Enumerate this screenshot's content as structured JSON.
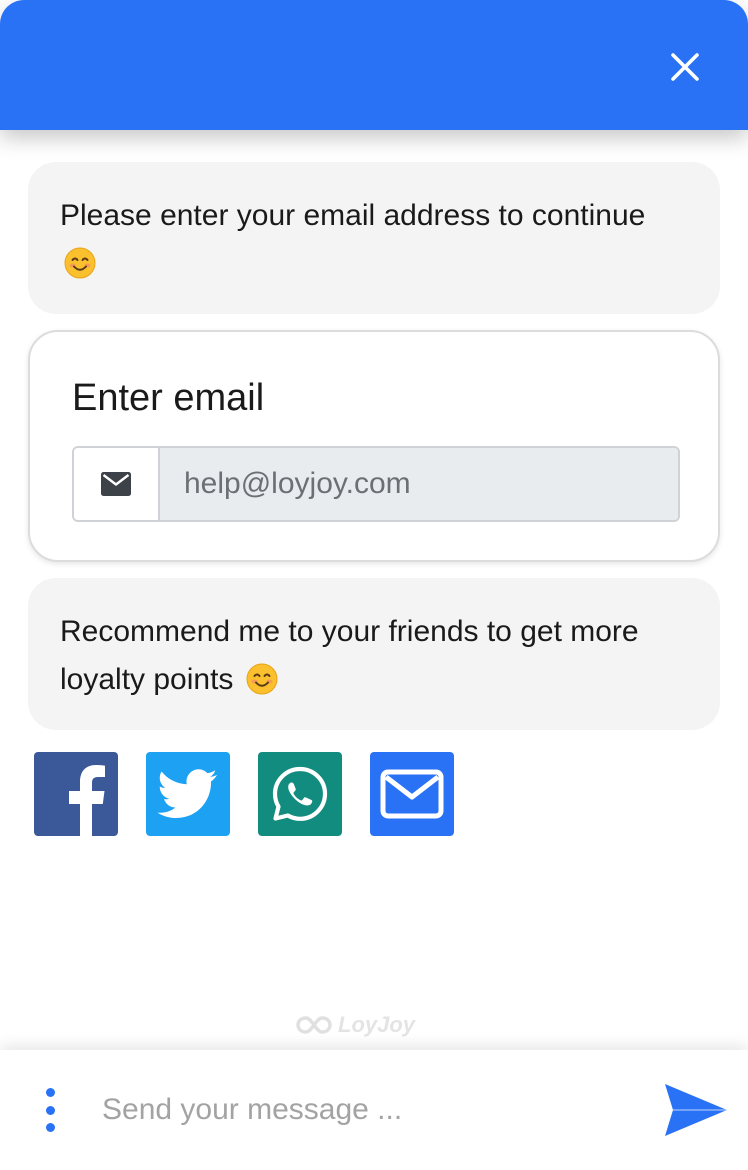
{
  "colors": {
    "header": "#2a72f5",
    "bubble": "#f4f4f4",
    "facebook": "#3b5998",
    "twitter": "#1da1f2",
    "whatsapp": "#128c7e",
    "email": "#2a72f5"
  },
  "header": {
    "close_icon": "close-icon"
  },
  "messages": [
    {
      "text": "Please enter your email address to continue",
      "emoji": "smiling-face-emoji"
    },
    {
      "text": "Recommend me to your friends to get more loyalty points",
      "emoji": "smiling-face-emoji"
    }
  ],
  "email_form": {
    "title": "Enter email",
    "prefix_icon": "envelope-icon",
    "placeholder": "help@loyjoy.com",
    "value": ""
  },
  "share_buttons": [
    {
      "network": "Facebook",
      "icon": "facebook-icon"
    },
    {
      "network": "Twitter",
      "icon": "twitter-icon"
    },
    {
      "network": "WhatsApp",
      "icon": "whatsapp-icon"
    },
    {
      "network": "Email",
      "icon": "email-icon"
    }
  ],
  "branding": {
    "name": "LoyJoy"
  },
  "composer": {
    "placeholder": "Send your message ...",
    "value": "",
    "menu_icon": "more-vertical-icon",
    "send_icon": "send-icon"
  }
}
